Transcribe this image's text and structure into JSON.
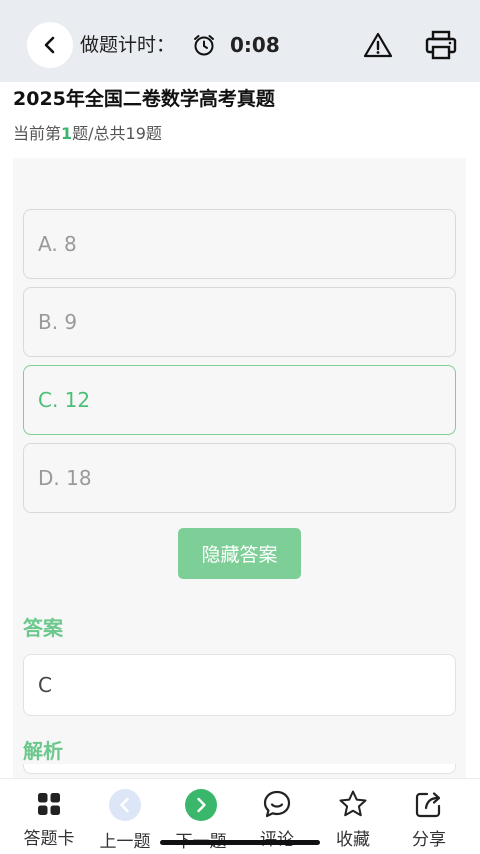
{
  "header": {
    "timer_label": "做题计时：",
    "timer_value": "0:08"
  },
  "exam": {
    "title": "2025年全国二卷数学高考真题",
    "progress_prefix": "当前第",
    "progress_current": "1",
    "progress_suffix": "题/总共19题"
  },
  "options": [
    {
      "label": "A. 8"
    },
    {
      "label": "B. 9"
    },
    {
      "label": "C. 12"
    },
    {
      "label": "D. 18"
    }
  ],
  "hide_answer_label": "隐藏答案",
  "answer": {
    "heading": "答案",
    "value": "C"
  },
  "analysis": {
    "heading": "解析"
  },
  "tabbar": [
    {
      "label": "答题卡",
      "icon": "grid-icon"
    },
    {
      "label": "上一题",
      "icon": "chevron-left-icon"
    },
    {
      "label": "下一题",
      "icon": "chevron-right-icon"
    },
    {
      "label": "评论",
      "icon": "comment-icon"
    },
    {
      "label": "收藏",
      "icon": "star-icon"
    },
    {
      "label": "分享",
      "icon": "share-icon"
    }
  ],
  "colors": {
    "accent": "#3bb76b",
    "accent_light": "#7ecf97",
    "header_bg": "#e9ecf1"
  }
}
